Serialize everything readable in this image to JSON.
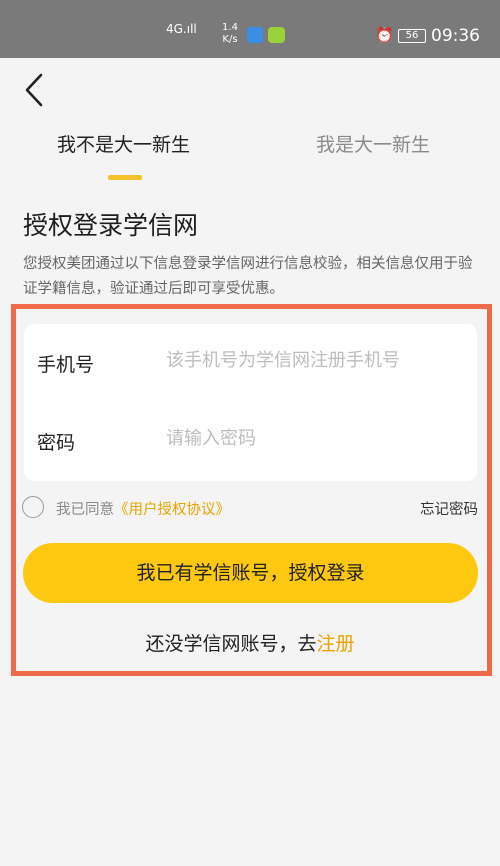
{
  "status_bar": {
    "signal": "4G.ıll",
    "net_speed": "1.4",
    "net_speed_unit": "K/s",
    "battery": "56",
    "time": "09:36"
  },
  "nav": {
    "back_icon": "chevron-left-icon"
  },
  "tabs": [
    {
      "label": "我不是大一新生",
      "active": true
    },
    {
      "label": "我是大一新生",
      "active": false
    }
  ],
  "page": {
    "title": "授权登录学信网",
    "description": "您授权美团通过以下信息登录学信网进行信息校验，相关信息仅用于验证学籍信息，验证通过后即可享受优惠。"
  },
  "form": {
    "phone_label": "手机号",
    "phone_placeholder": "该手机号为学信网注册手机号",
    "password_label": "密码",
    "password_placeholder": "请输入密码"
  },
  "agreement": {
    "prefix": "我已同意",
    "link": "《用户授权协议》",
    "forgot": "忘记密码"
  },
  "actions": {
    "login_label": "我已有学信账号，授权登录",
    "register_prefix": "还没学信网账号，去",
    "register_link": "注册"
  },
  "colors": {
    "accent": "#fdc80f",
    "link": "#e8a400",
    "highlight_border": "#ee6a4a"
  }
}
